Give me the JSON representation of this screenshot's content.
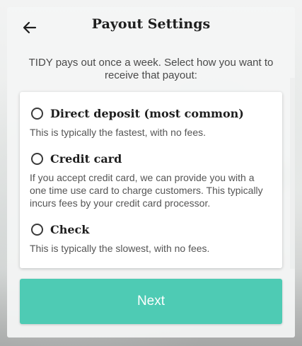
{
  "header": {
    "title": "Payout Settings",
    "back_icon": "arrow-left-icon"
  },
  "intro": {
    "text": "TIDY pays out once a week. Select how you want to receive that payout:"
  },
  "options": [
    {
      "label": "Direct deposit (most common)",
      "description": "This is typically the fastest, with no fees.",
      "selected": false
    },
    {
      "label": "Credit card",
      "description": "If you accept credit card, we can provide you with a one time use card to charge customers. This typically incurs fees by your credit card processor.",
      "selected": false
    },
    {
      "label": "Check",
      "description": "This is typically the slowest, with no fees.",
      "selected": false
    }
  ],
  "actions": {
    "next_label": "Next"
  },
  "colors": {
    "accent": "#4ecbb4",
    "title_text": "#1e1e1e",
    "body_text": "#555555"
  }
}
